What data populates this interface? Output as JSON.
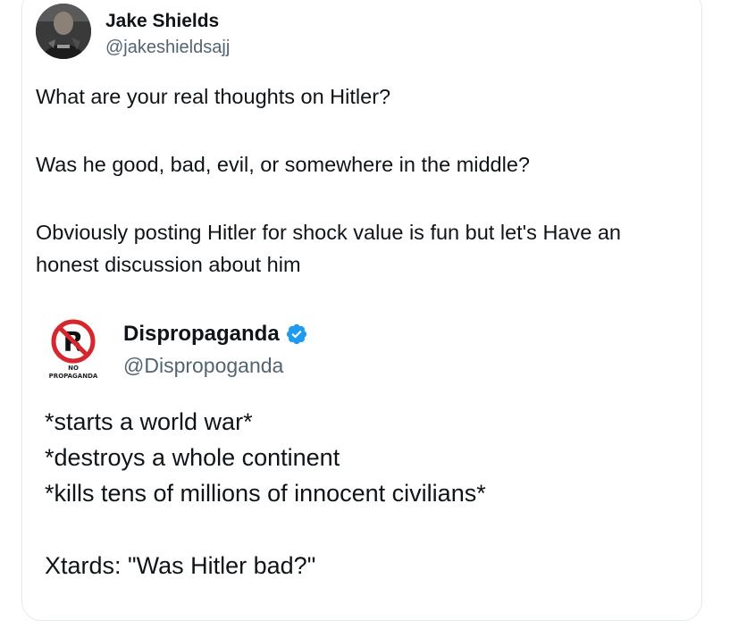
{
  "tweet": {
    "author": {
      "name": "Jake Shields",
      "handle": "@jakeshieldsajj",
      "avatar_icon": "profile-photo"
    },
    "paragraphs": [
      "What are your real thoughts on Hitler?",
      "Was he good, bad, evil, or somewhere in the middle?",
      "Obviously posting Hitler for shock value is fun but let's Have an honest discussion about him"
    ]
  },
  "quoted_tweet": {
    "author": {
      "name": "Dispropaganda",
      "handle": "@Dispropoganda",
      "verified": true,
      "verified_color": "#1d9bf0",
      "avatar_icon": "no-propaganda-logo",
      "avatar_logo_text": "NO PROPAGANDA"
    },
    "lines": [
      "*starts a world war*",
      "*destroys a whole continent",
      "*kills tens of millions of innocent civilians*"
    ],
    "closing_line": "Xtards: \"Was Hitler bad?\""
  },
  "colors": {
    "text_primary": "#0f1419",
    "text_secondary": "#536471",
    "border": "#e6e8eb",
    "logo_red": "#d7262d"
  }
}
